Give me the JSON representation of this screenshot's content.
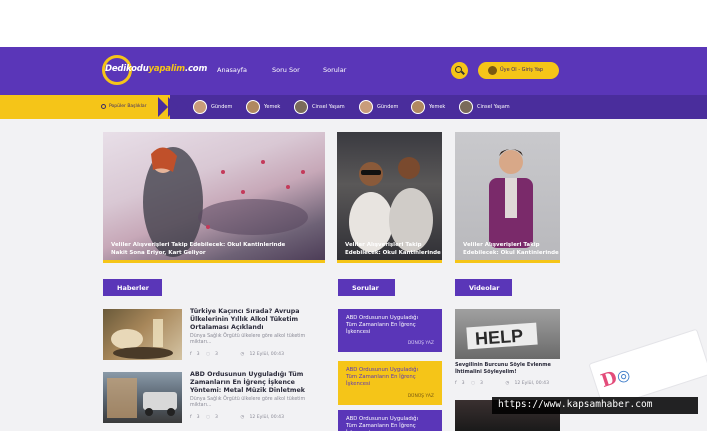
{
  "brand": {
    "part1": "Dedikodu",
    "part2": "yapalim",
    "part3": ".com"
  },
  "nav": [
    "Anasayfa",
    "Soru Sor",
    "Sorular"
  ],
  "login": {
    "label": "Üye Ol - Giriş Yap"
  },
  "trending": {
    "label": "Popüler Başlıklar",
    "chips": [
      "Gündem",
      "Yemek",
      "Cinsel Yaşam",
      "Gündem",
      "Yemek",
      "Cinsel Yaşam"
    ]
  },
  "featured": [
    {
      "caption_line1": "Veliler Alışverişleri Takip Edebilecek: Okul Kantinlerinde",
      "caption_line2": "Nakit Sona Eriyor, Kart Geliyor"
    },
    {
      "caption_line1": "Veliler Alışverişleri Takip",
      "caption_line2": "Edebilecek: Okul Kantinlerinde"
    },
    {
      "caption_line1": "Veliler Alışverişleri Takip",
      "caption_line2": "Edebilecek: Okul Kantinlerinde"
    }
  ],
  "sections": {
    "news": "Haberler",
    "questions": "Sorular",
    "videos": "Videolar"
  },
  "articles": [
    {
      "title": "Türkiye Kaçıncı Sırada? Avrupa Ülkelerinin Yıllık Alkol Tüketim Ortalaması Açıklandı",
      "desc": "Dünya Sağlık Örgütü ülkelere göre alkol tüketim miktarı...",
      "likes": "3",
      "comments": "3",
      "date": "12 Eylül, 00:43"
    },
    {
      "title": "ABD Ordusunun Uyguladığı Tüm Zamanların En İğrenç İşkence Yöntemi: Metal Müzik Dinletmek",
      "desc": "Dünya Sağlık Örgütü ülkelere göre alkol tüketim miktarı...",
      "likes": "3",
      "comments": "3",
      "date": "12 Eylül, 00:43"
    }
  ],
  "questions": [
    {
      "text": "ABD Ordusunun Uyguladığı Tüm Zamanların En İğrenç İşkencesi",
      "tag": "DÜNÜŞ YAZ"
    },
    {
      "text": "ABD Ordusunun Uyguladığı Tüm Zamanların En İğrenç İşkencesi",
      "tag": "DÜNÜŞ YAZ"
    },
    {
      "text": "ABD Ordusunun Uyguladığı Tüm Zamanların En İğrenç İşkencesi",
      "tag": "DÜNÜŞ YAZ"
    }
  ],
  "video": {
    "thumb_text": "HELP",
    "title": "Sevgilinin Burcunu Söyle Evlenme İhtimalini Söyleyelim!",
    "likes": "3",
    "comments": "3",
    "date": "12 Eylül, 00:43"
  },
  "watermark": {
    "url": "https://www.kapsamhaber.com"
  },
  "colors": {
    "purple": "#5a36b8",
    "dark_purple": "#4a2d9c",
    "yellow": "#f5c518",
    "background": "#f2f2f4"
  }
}
